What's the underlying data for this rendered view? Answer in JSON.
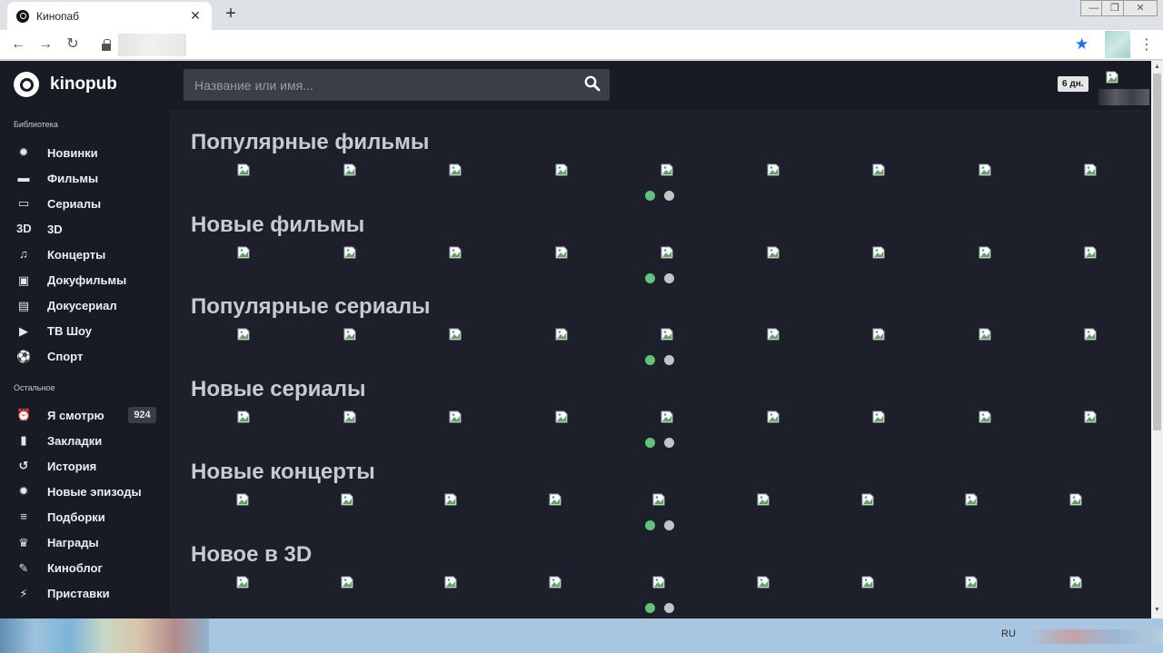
{
  "browser": {
    "tab_title": "Кинопаб",
    "tab_close": "✕",
    "new_tab": "+",
    "window_controls": [
      "—",
      "❐",
      "✕"
    ],
    "nav": {
      "back": "←",
      "forward": "→",
      "reload": "↻"
    },
    "menu": "⋮",
    "bookmark_icon": "★"
  },
  "site": {
    "brand": "kinopub",
    "search_placeholder": "Название или имя...",
    "days_badge": "6 дн."
  },
  "sidebar": {
    "library_label": "Библиотека",
    "library_items": [
      {
        "label": "Новинки",
        "icon": "✹"
      },
      {
        "label": "Фильмы",
        "icon": "▬"
      },
      {
        "label": "Сериалы",
        "icon": "▭"
      },
      {
        "label": "3D",
        "icon": "3D"
      },
      {
        "label": "Концерты",
        "icon": "♫"
      },
      {
        "label": "Докуфильмы",
        "icon": "▣"
      },
      {
        "label": "Докусериал",
        "icon": "▤"
      },
      {
        "label": "ТВ Шоу",
        "icon": "▶"
      },
      {
        "label": "Спорт",
        "icon": "⚽"
      }
    ],
    "other_label": "Остальное",
    "other_items": [
      {
        "label": "Я смотрю",
        "icon": "⏰",
        "badge": "924"
      },
      {
        "label": "Закладки",
        "icon": "▮"
      },
      {
        "label": "История",
        "icon": "↺"
      },
      {
        "label": "Новые эпизоды",
        "icon": "✹"
      },
      {
        "label": "Подборки",
        "icon": "≡"
      },
      {
        "label": "Награды",
        "icon": "♛"
      },
      {
        "label": "Киноблог",
        "icon": "✎"
      },
      {
        "label": "Приставки",
        "icon": "⚡"
      }
    ]
  },
  "sections": [
    {
      "title": "Популярные фильмы",
      "thumb_count": 9
    },
    {
      "title": "Новые фильмы",
      "thumb_count": 9
    },
    {
      "title": "Популярные сериалы",
      "thumb_count": 9
    },
    {
      "title": "Новые сериалы",
      "thumb_count": 9
    },
    {
      "title": "Новые концерты",
      "thumb_count": 9
    },
    {
      "title": "Новое в 3D",
      "thumb_count": 9
    }
  ],
  "carousel": {
    "pages": 2,
    "active_page": 1,
    "active_color": "#5fc47a",
    "inactive_color": "#c4c4c4"
  },
  "taskbar": {
    "language": "RU"
  }
}
